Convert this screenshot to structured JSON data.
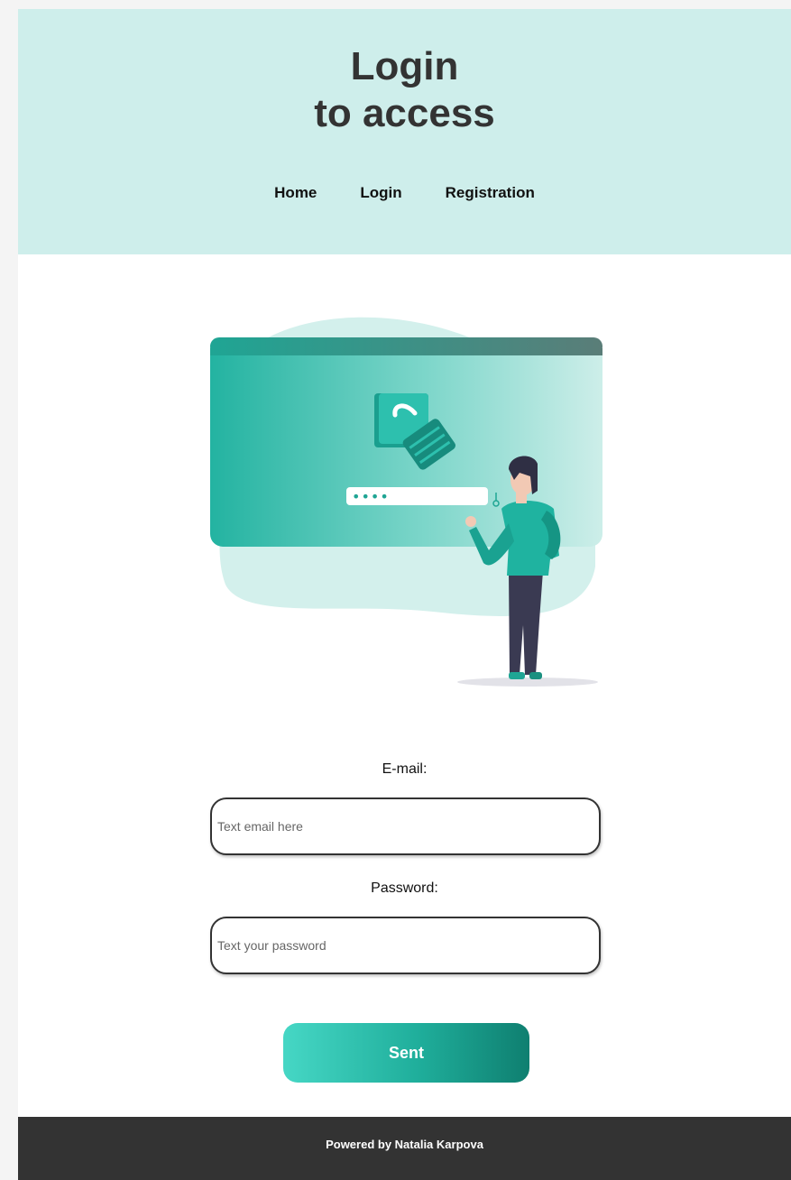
{
  "header": {
    "title_line1": "Login",
    "title_line2": "to access"
  },
  "nav": {
    "items": [
      {
        "label": "Home"
      },
      {
        "label": "Login"
      },
      {
        "label": "Registration"
      }
    ]
  },
  "illustration": {
    "subject": "person-login-screen",
    "password_dots": "••••"
  },
  "form": {
    "email_label": "E-mail:",
    "email_placeholder": "Text email here",
    "email_value": "",
    "password_label": "Password:",
    "password_placeholder": "Text your password",
    "password_value": "",
    "submit_label": "Sent"
  },
  "footer": {
    "text": "Powered by Natalia Karpova"
  },
  "colors": {
    "header_bg": "#ceeeeb",
    "accent": "#1fae9b",
    "footer_bg": "#333333"
  }
}
